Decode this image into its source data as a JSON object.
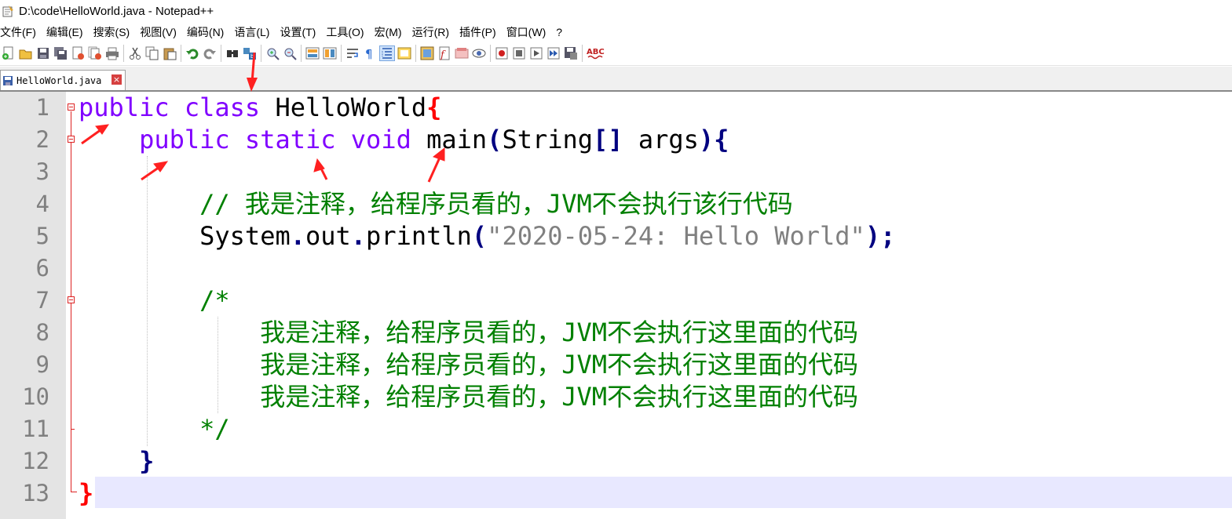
{
  "window": {
    "title": "D:\\code\\HelloWorld.java - Notepad++"
  },
  "menu": {
    "items": [
      "文件(F)",
      "编辑(E)",
      "搜索(S)",
      "视图(V)",
      "编码(N)",
      "语言(L)",
      "设置(T)",
      "工具(O)",
      "宏(M)",
      "运行(R)",
      "插件(P)",
      "窗口(W)",
      "?"
    ]
  },
  "toolbar": {
    "icons": [
      "new-file-icon",
      "open-file-icon",
      "save-icon",
      "save-all-icon",
      "close-icon",
      "close-all-icon",
      "print-icon",
      "cut-icon",
      "copy-icon",
      "paste-icon",
      "undo-icon",
      "redo-icon",
      "find-icon",
      "replace-icon",
      "zoom-in-icon",
      "zoom-out-icon",
      "sync-vertical-icon",
      "sync-horizontal-icon",
      "word-wrap-icon",
      "show-all-chars-icon",
      "indent-guide-icon",
      "language-icon",
      "function-list-icon",
      "folder-as-workspace-icon",
      "doc-map-icon",
      "monitoring-icon",
      "record-macro-icon",
      "stop-record-icon",
      "play-macro-icon",
      "run-macro-multiple-icon",
      "save-macro-icon",
      "spell-check-icon"
    ],
    "spell_label": "ABC"
  },
  "tab": {
    "label": "HelloWorld.java",
    "close_glyph": "×"
  },
  "editor": {
    "line_numbers": [
      "1",
      "2",
      "3",
      "4",
      "5",
      "6",
      "7",
      "8",
      "9",
      "10",
      "11",
      "12",
      "13"
    ],
    "lines": {
      "l1": {
        "kw1": "public",
        "kw2": "class",
        "name": "HelloWorld",
        "brace": "{"
      },
      "l2": {
        "kw1": "public",
        "kw2": "static",
        "kw3": "void",
        "name": "main",
        "paren_open": "(",
        "type": "String",
        "brackets": "[]",
        "arg": "args",
        "paren_close": ")",
        "brace": "{"
      },
      "l4": {
        "comment": "// 我是注释，给程序员看的，JVM不会执行该行代码"
      },
      "l5": {
        "obj": "System",
        "dot1": ".",
        "field": "out",
        "dot2": ".",
        "method": "println",
        "paren_open": "(",
        "string": "\"2020-05-24: Hello World\"",
        "paren_close": ")",
        "semi": ";"
      },
      "l7": {
        "comment": "/*"
      },
      "l8": {
        "comment": "我是注释，给程序员看的，JVM不会执行这里面的代码"
      },
      "l9": {
        "comment": "我是注释，给程序员看的，JVM不会执行这里面的代码"
      },
      "l10": {
        "comment": "我是注释，给程序员看的，JVM不会执行这里面的代码"
      },
      "l11": {
        "comment": "*/"
      },
      "l12": {
        "brace": "}"
      },
      "l13": {
        "brace": "}"
      }
    }
  },
  "colors": {
    "keyword": "#8000ff",
    "brace": "#ff0000",
    "operator": "#000080",
    "string": "#808080",
    "comment": "#008000",
    "annotation_arrow": "#ff2020"
  }
}
